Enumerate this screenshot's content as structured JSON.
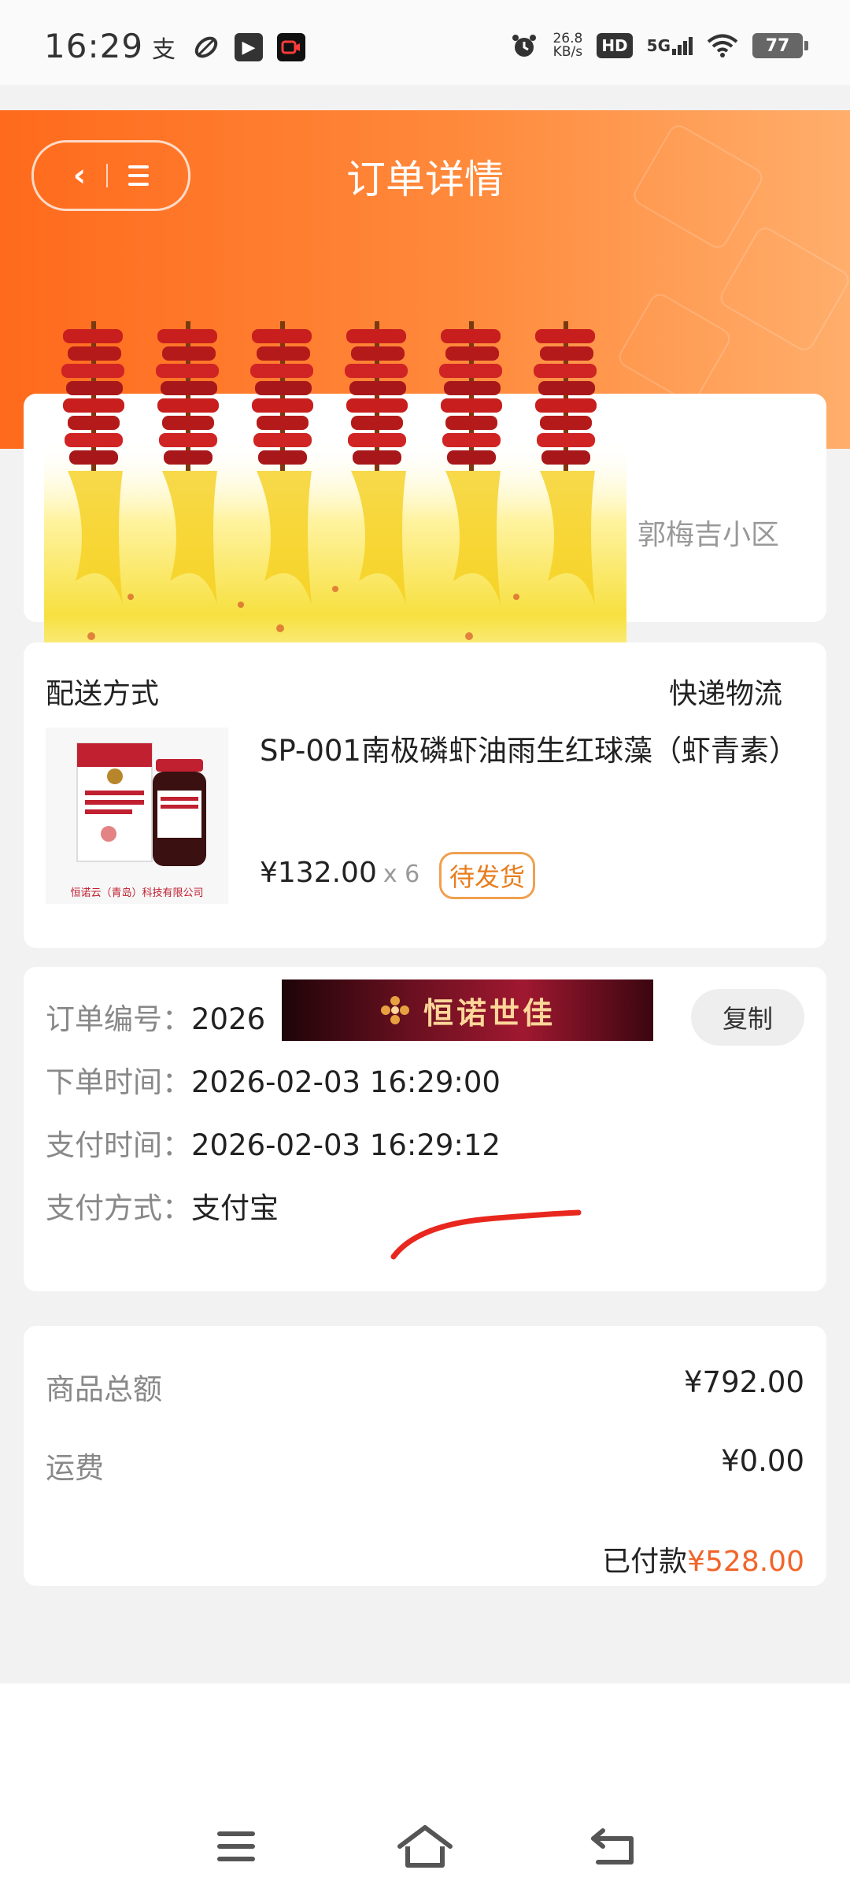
{
  "status_bar": {
    "time": "16:29",
    "net_speed_value": "26.8",
    "net_speed_unit": "KB/s",
    "hd": "HD",
    "network": "5G",
    "battery": "77",
    "icons": [
      "alipay-icon",
      "leaf-icon",
      "play-icon",
      "camera-icon",
      "alarm-icon",
      "wifi-icon",
      "signal-icon"
    ]
  },
  "header": {
    "title": "订单详情",
    "back_icon": "chevron-left-icon",
    "menu_icon": "menu-icon",
    "color_start": "#ff6a1c",
    "color_end": "#ffae6c"
  },
  "address": {
    "visible_text": "郭梅吉小区"
  },
  "shipping": {
    "label": "配送方式",
    "value": "快递物流"
  },
  "product": {
    "name": "SP-001南极磷虾油雨生红球藻（虾青素）",
    "price": "¥132.00",
    "qty": "x 6",
    "status_tag": "待发货",
    "image_company": "恒诺云（青岛）科技有限公司"
  },
  "order_info": {
    "order_no_label": "订单编号：",
    "order_no_value": "2026",
    "copy_label": "复制",
    "banner_text": "恒诺世佳",
    "order_time_label": "下单时间：",
    "order_time_value": "2026-02-03 16:29:00",
    "pay_time_label": "支付时间：",
    "pay_time_value": "2026-02-03 16:29:12",
    "pay_method_label": "支付方式：",
    "pay_method_value": "支付宝"
  },
  "summary": {
    "goods_total_label": "商品总额",
    "goods_total_value": "¥792.00",
    "freight_label": "运费",
    "freight_value": "¥0.00",
    "paid_label": "已付款",
    "paid_value": "¥528.00",
    "paid_color": "#f0652a"
  },
  "nav_bar": {
    "items": [
      "menu-icon",
      "home-icon",
      "back-icon"
    ]
  }
}
